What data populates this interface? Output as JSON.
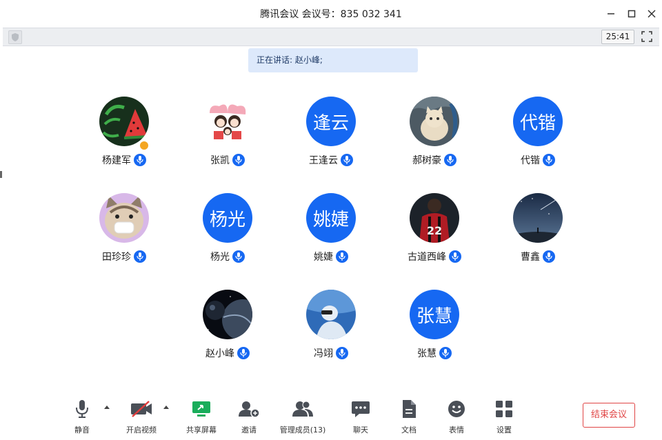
{
  "window": {
    "title": "腾讯会议 会议号：835 032 341",
    "controls": [
      "minimize-icon",
      "maximize-icon",
      "close-icon"
    ]
  },
  "infobar": {
    "timer": "25:41",
    "icons": [
      "shield-icon",
      "fullscreen-icon"
    ]
  },
  "speaking": {
    "text": "正在讲话: 赵小峰;"
  },
  "colors": {
    "accent": "#1668f2",
    "end_button": "#e04444",
    "speaking_bg": "#dde9fb",
    "share_green": "#1aad5b"
  },
  "participants": [
    {
      "name": "杨建军",
      "avatar_text": "",
      "avatar_kind": "watermelon-photo",
      "host": true
    },
    {
      "name": "张凯",
      "avatar_text": "",
      "avatar_kind": "cartoon-family-photo"
    },
    {
      "name": "王逢云",
      "avatar_text": "逢云",
      "avatar_kind": "text"
    },
    {
      "name": "郝树豪",
      "avatar_text": "",
      "avatar_kind": "cat-photo"
    },
    {
      "name": "代锴",
      "avatar_text": "代锴",
      "avatar_kind": "text"
    },
    {
      "name": "田珍珍",
      "avatar_text": "",
      "avatar_kind": "masked-cat-photo"
    },
    {
      "name": "杨光",
      "avatar_text": "杨光",
      "avatar_kind": "text"
    },
    {
      "name": "姚婕",
      "avatar_text": "姚婕",
      "avatar_kind": "text"
    },
    {
      "name": "古道西峰",
      "avatar_text": "",
      "avatar_kind": "jersey-photo"
    },
    {
      "name": "曹鑫",
      "avatar_text": "",
      "avatar_kind": "night-sky-photo"
    },
    {
      "name": "赵小峰",
      "avatar_text": "",
      "avatar_kind": "planet-photo"
    },
    {
      "name": "冯翊",
      "avatar_text": "",
      "avatar_kind": "blue-figure-photo"
    },
    {
      "name": "张慧",
      "avatar_text": "张慧",
      "avatar_kind": "text"
    }
  ],
  "toolbar": {
    "mute": "静音",
    "video": "开启视频",
    "share": "共享屏幕",
    "invite": "邀请",
    "manage": "管理成员(13)",
    "chat": "聊天",
    "docs": "文档",
    "reactions": "表情",
    "settings": "设置",
    "end": "结束会议"
  }
}
